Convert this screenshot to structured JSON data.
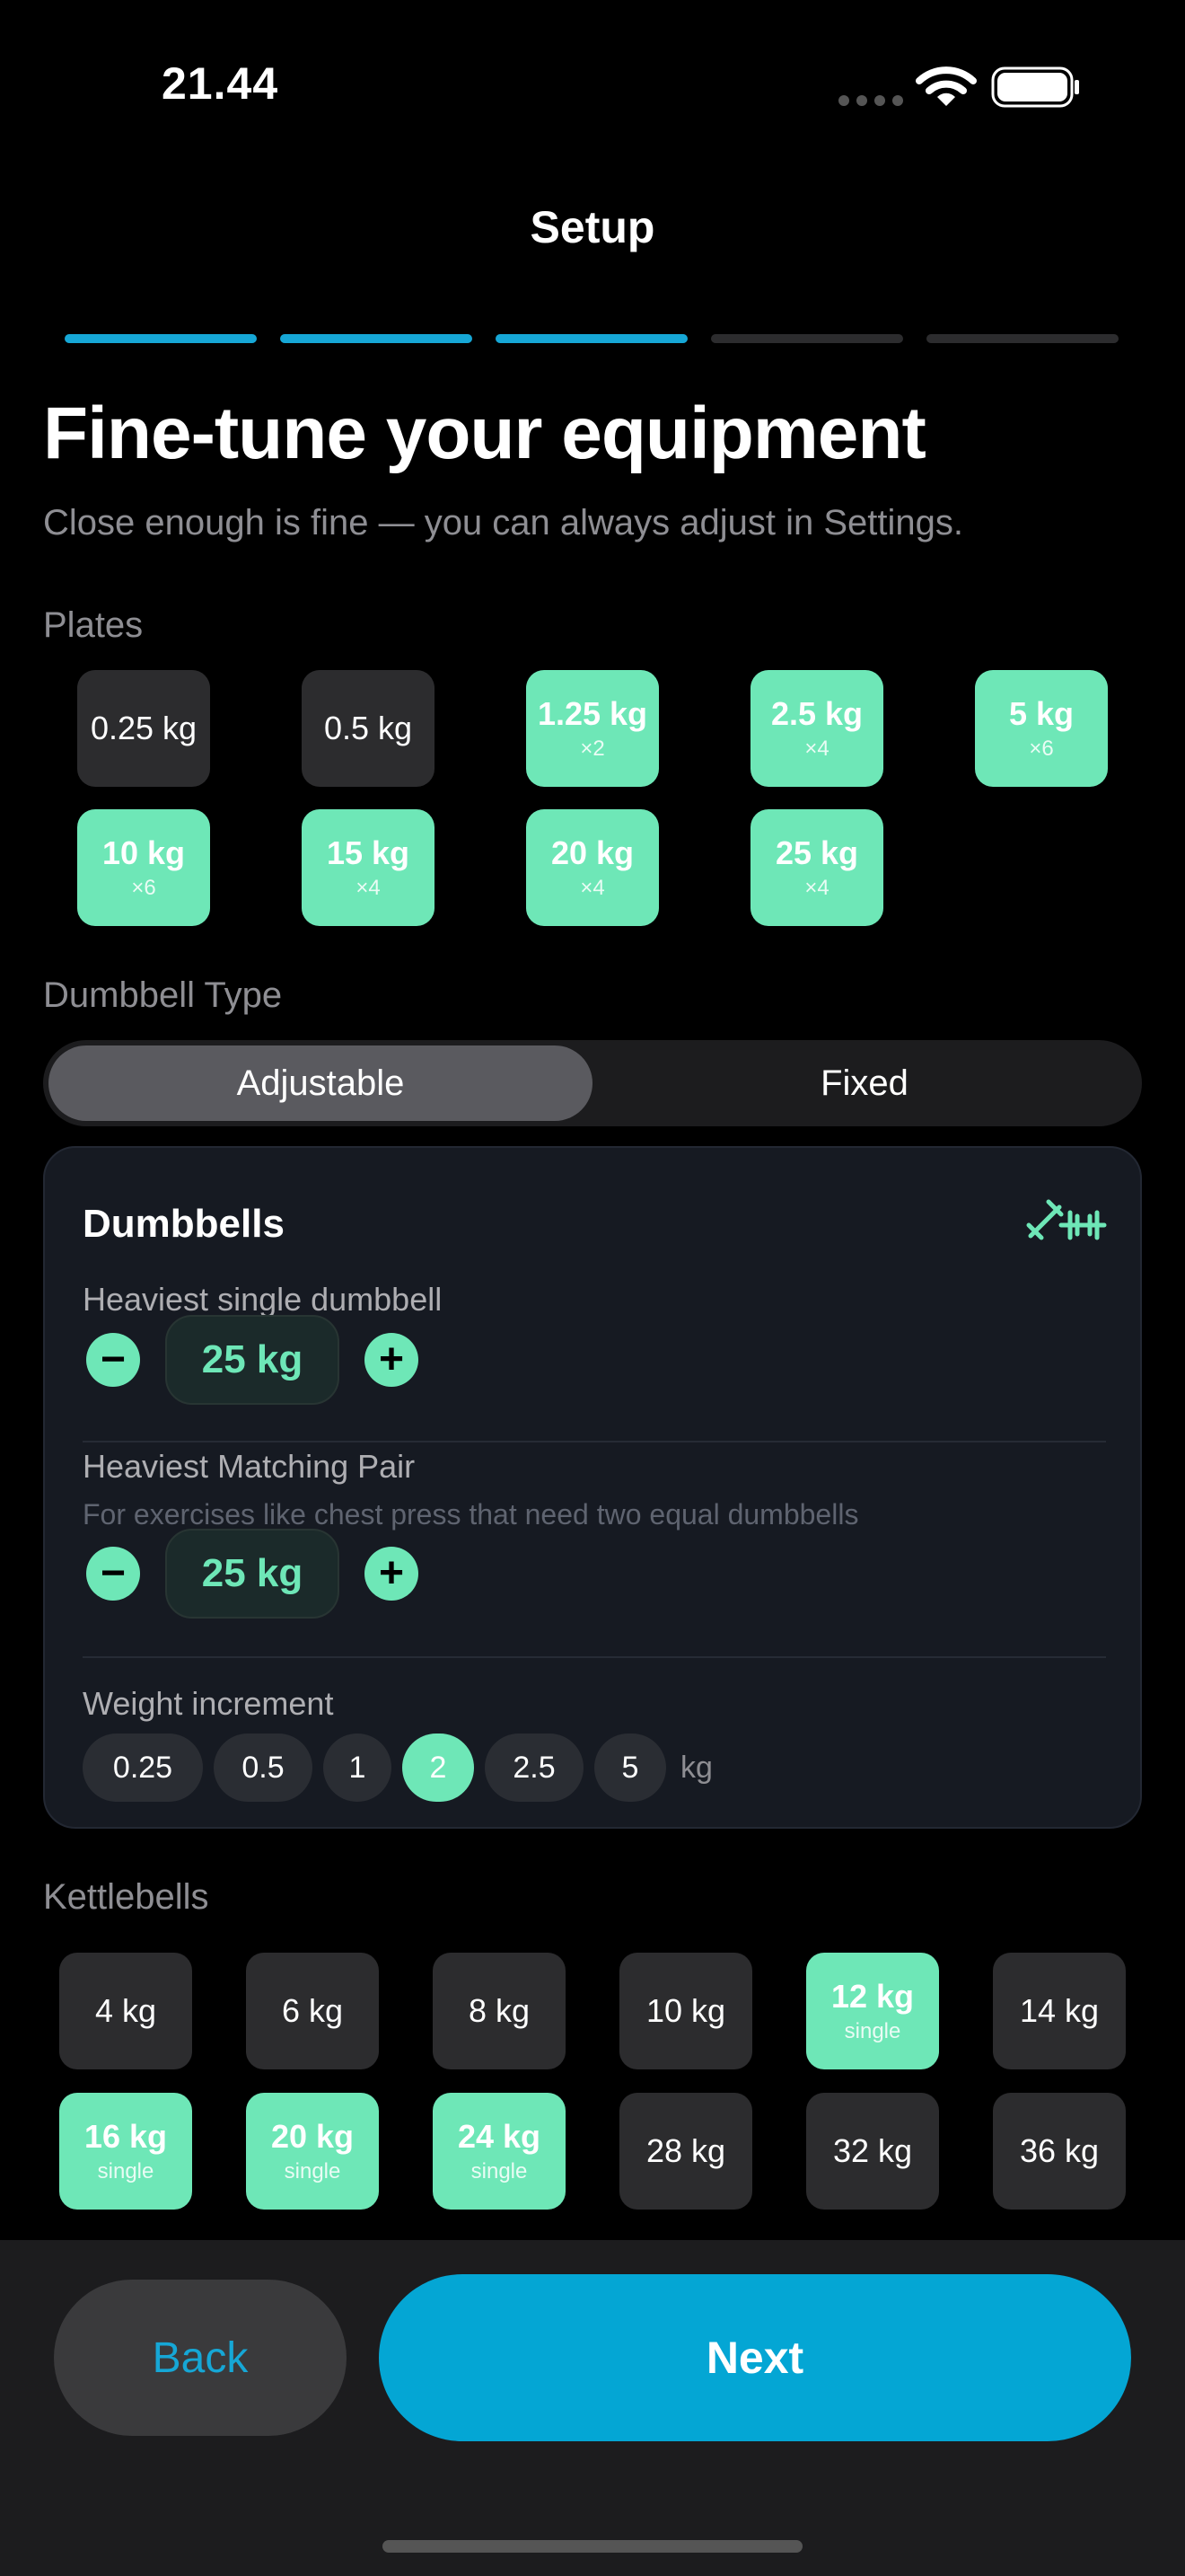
{
  "status": {
    "time": "21.44"
  },
  "header": {
    "title": "Setup"
  },
  "progress": {
    "total_steps": 5,
    "completed_steps": 3
  },
  "page": {
    "title": "Fine-tune your equipment",
    "subtitle": "Close enough is fine — you can always adjust in Settings."
  },
  "plates": {
    "label": "Plates",
    "items": [
      {
        "weight": "0.25 kg",
        "count": "",
        "selected": false
      },
      {
        "weight": "0.5 kg",
        "count": "",
        "selected": false
      },
      {
        "weight": "1.25 kg",
        "count": "×2",
        "selected": true
      },
      {
        "weight": "2.5 kg",
        "count": "×4",
        "selected": true
      },
      {
        "weight": "5 kg",
        "count": "×6",
        "selected": true
      },
      {
        "weight": "10 kg",
        "count": "×6",
        "selected": true
      },
      {
        "weight": "15 kg",
        "count": "×4",
        "selected": true
      },
      {
        "weight": "20 kg",
        "count": "×4",
        "selected": true
      },
      {
        "weight": "25 kg",
        "count": "×4",
        "selected": true
      }
    ]
  },
  "dumbbell_type": {
    "label": "Dumbbell Type",
    "options": [
      "Adjustable",
      "Fixed"
    ],
    "selected": "Adjustable"
  },
  "dumbbells": {
    "title": "Dumbbells",
    "heaviest_single": {
      "label": "Heaviest single dumbbell",
      "value": "25 kg"
    },
    "heaviest_pair": {
      "label": "Heaviest Matching Pair",
      "hint": "For exercises like chest press that need two equal dumbbells",
      "value": "25 kg"
    },
    "increment": {
      "label": "Weight increment",
      "options": [
        "0.25",
        "0.5",
        "1",
        "2",
        "2.5",
        "5"
      ],
      "selected": "2",
      "unit": "kg"
    }
  },
  "kettlebells": {
    "label": "Kettlebells",
    "items": [
      {
        "weight": "4 kg",
        "tag": "",
        "selected": false
      },
      {
        "weight": "6 kg",
        "tag": "",
        "selected": false
      },
      {
        "weight": "8 kg",
        "tag": "",
        "selected": false
      },
      {
        "weight": "10 kg",
        "tag": "",
        "selected": false
      },
      {
        "weight": "12 kg",
        "tag": "single",
        "selected": true
      },
      {
        "weight": "14 kg",
        "tag": "",
        "selected": false
      },
      {
        "weight": "16 kg",
        "tag": "single",
        "selected": true
      },
      {
        "weight": "20 kg",
        "tag": "single",
        "selected": true
      },
      {
        "weight": "24 kg",
        "tag": "single",
        "selected": true
      },
      {
        "weight": "28 kg",
        "tag": "",
        "selected": false
      },
      {
        "weight": "32 kg",
        "tag": "",
        "selected": false
      },
      {
        "weight": "36 kg",
        "tag": "",
        "selected": false
      }
    ]
  },
  "footer": {
    "back_label": "Back",
    "next_label": "Next"
  },
  "colors": {
    "accent": "#6ee7b7",
    "primary": "#04a6d4",
    "background": "#000000"
  }
}
